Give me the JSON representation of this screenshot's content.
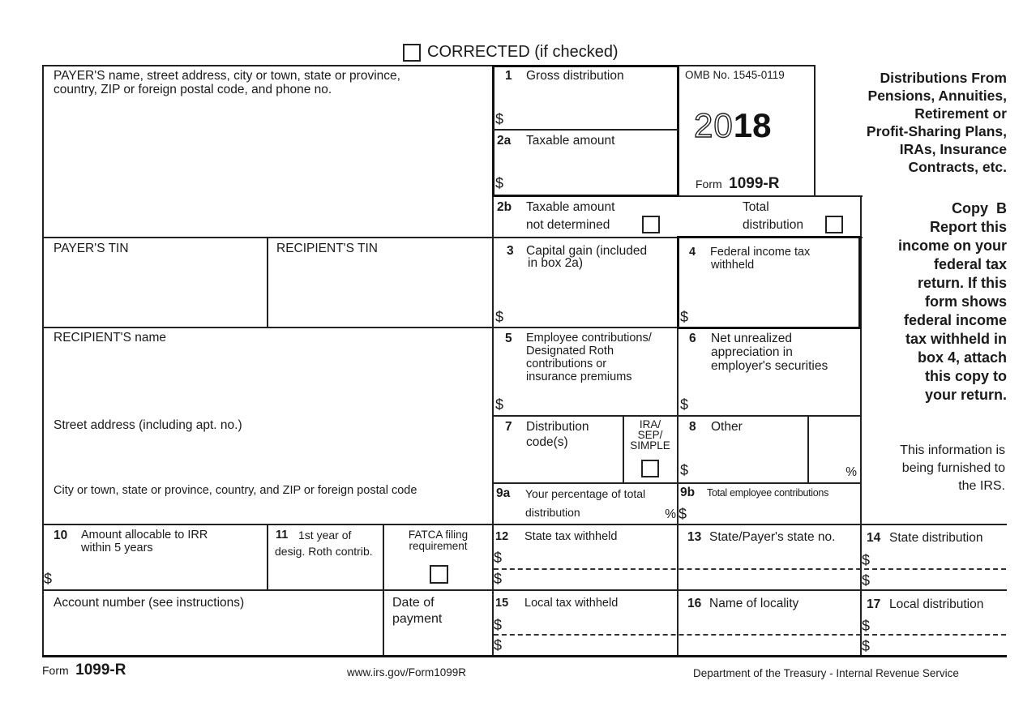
{
  "form": {
    "corrected_label": "CORRECTED (if checked)",
    "payer_info_label": "PAYER'S name, street address, city or town, state or province, country, ZIP or foreign postal code, and phone no.",
    "payer_info_line1": "PAYER'S name, street address, city or town, state or province,",
    "payer_info_line2": "country, ZIP or foreign postal code, and phone no.",
    "payer_tin_label": "PAYER'S TIN",
    "recipient_tin_label": "RECIPIENT'S TIN",
    "recipient_name_label": "RECIPIENT'S name",
    "street_address_label": "Street address (including apt. no.)",
    "city_label": "City or town, state or province, country, and ZIP or foreign postal code",
    "account_number_label": "Account number (see instructions)",
    "date_of_payment_line1": "Date of",
    "date_of_payment_line2": "payment",
    "currency_symbol": "$",
    "percent_symbol": "%",
    "omb": {
      "label": "OMB No. 1545-0119",
      "year_outline": "20",
      "year_bold": "18",
      "form_prefix": "Form",
      "form_name": "1099-R"
    },
    "title_lines": [
      "Distributions From",
      "Pensions, Annuities,",
      "Retirement or",
      "Profit-Sharing Plans,",
      "IRAs, Insurance",
      "Contracts, etc."
    ],
    "copy": {
      "heading": "Copy  B",
      "instructions_lines": [
        "Report this",
        "income on your",
        "federal tax",
        "return. If this",
        "form shows",
        "federal income",
        "tax withheld in",
        "box 4, attach",
        "this copy to",
        "your return."
      ],
      "irs_notice_lines": [
        "This information is",
        "being furnished to",
        "the IRS."
      ]
    },
    "boxes": {
      "b1": {
        "num": "1",
        "label": "Gross distribution"
      },
      "b2a": {
        "num": "2a",
        "label": "Taxable amount"
      },
      "b2b": {
        "num": "2b",
        "label_line1": "Taxable amount",
        "label_line2": "not determined"
      },
      "total_distribution": {
        "label_line1": "Total",
        "label_line2": "distribution"
      },
      "b3": {
        "num": "3",
        "label_line1": "Capital gain (included",
        "label_line2": "in box 2a)"
      },
      "b4": {
        "num": "4",
        "label_line1": "Federal income tax",
        "label_line2": "withheld"
      },
      "b5": {
        "num": "5",
        "label_lines": [
          "Employee contributions/",
          "Designated Roth",
          "contributions or",
          "insurance premiums"
        ]
      },
      "b6": {
        "num": "6",
        "label_lines": [
          "Net unrealized",
          "appreciation in",
          "employer's securities"
        ]
      },
      "b7": {
        "num": "7",
        "label_line1": "Distribution",
        "label_line2": "code(s)"
      },
      "ira_sep_simple": {
        "label_lines": [
          "IRA/",
          "SEP/",
          "SIMPLE"
        ]
      },
      "b8": {
        "num": "8",
        "label": "Other"
      },
      "b9a": {
        "num": "9a",
        "label_line1": "Your percentage of total",
        "label_line2": "distribution"
      },
      "b9b": {
        "num": "9b",
        "label": "Total employee contributions"
      },
      "b10": {
        "num": "10",
        "label_line1": "Amount allocable to IRR",
        "label_line2": "within 5 years"
      },
      "b11": {
        "num": "11",
        "label_line1": "1st year of",
        "label_line2": "desig. Roth contrib."
      },
      "fatca": {
        "label_line1": "FATCA filing",
        "label_line2": "requirement"
      },
      "b12": {
        "num": "12",
        "label": "State tax withheld"
      },
      "b13": {
        "num": "13",
        "label": "State/Payer's state no."
      },
      "b14": {
        "num": "14",
        "label": "State distribution"
      },
      "b15": {
        "num": "15",
        "label": "Local tax withheld"
      },
      "b16": {
        "num": "16",
        "label": "Name of locality"
      },
      "b17": {
        "num": "17",
        "label": "Local distribution"
      }
    },
    "footer": {
      "form_prefix": "Form",
      "form_name": "1099-R",
      "url": "www.irs.gov/Form1099R",
      "department": "Department of the Treasury - Internal Revenue Service"
    }
  }
}
